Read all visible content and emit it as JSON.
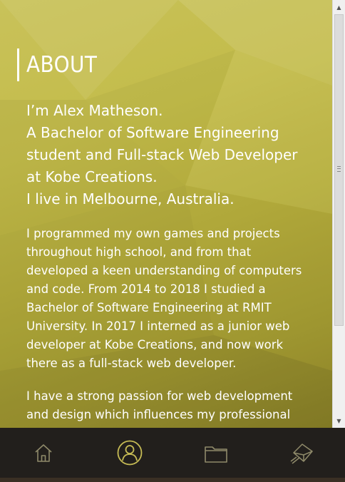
{
  "section": {
    "title": "ABOUT",
    "intro_lines": [
      "I’m Alex Matheson.",
      "A Bachelor of Software Engineering student and Full-stack Web Developer at Kobe Creations.",
      "I live in Melbourne, Australia."
    ],
    "paragraphs": [
      "I programmed my own games and projects throughout high school, and from that developed a keen understanding of computers and code. From 2014 to 2018 I studied a Bachelor of Software Engineering at RMIT University. In 2017 I interned as a junior web developer at Kobe Creations, and now work there as a full-stack web developer.",
      "I have a strong passion for web development and design which influences my professional work as well as my hobby projects."
    ]
  },
  "nav": {
    "items": [
      {
        "icon": "home-icon",
        "active": false
      },
      {
        "icon": "user-icon",
        "active": true
      },
      {
        "icon": "folder-icon",
        "active": false
      },
      {
        "icon": "envelope-icon",
        "active": false
      }
    ]
  },
  "colors": {
    "accent": "#c7bc55",
    "nav_background": "#221f1c",
    "nav_icon": "#8f8a6a"
  }
}
